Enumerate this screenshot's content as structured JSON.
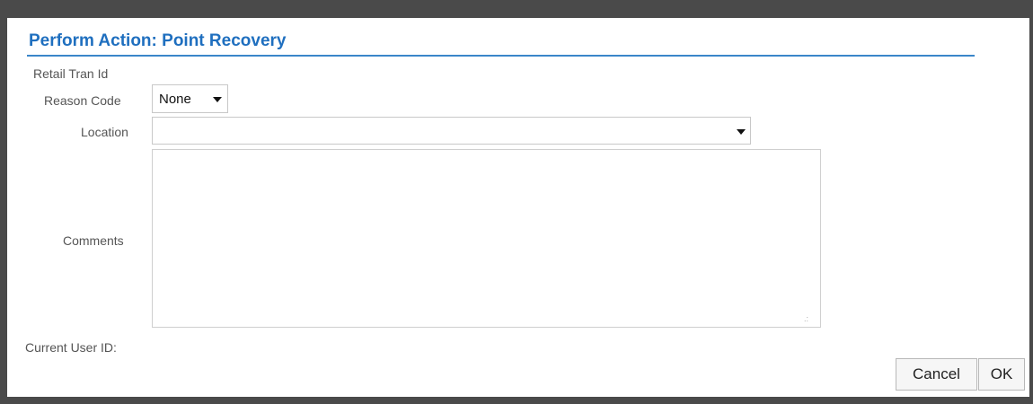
{
  "dialog": {
    "title": "Perform Action: Point Recovery"
  },
  "form": {
    "retail_tran_id_label": "Retail Tran Id",
    "reason_code_label": "Reason Code",
    "reason_code_value": "None",
    "location_label": "Location",
    "location_value": "",
    "comments_label": "Comments",
    "comments_value": "",
    "current_user_label": "Current User ID:"
  },
  "buttons": {
    "cancel": "Cancel",
    "ok": "OK"
  },
  "colors": {
    "title": "#1f6fbf",
    "rule": "#3a86c9",
    "frame": "#4a4a4a"
  }
}
